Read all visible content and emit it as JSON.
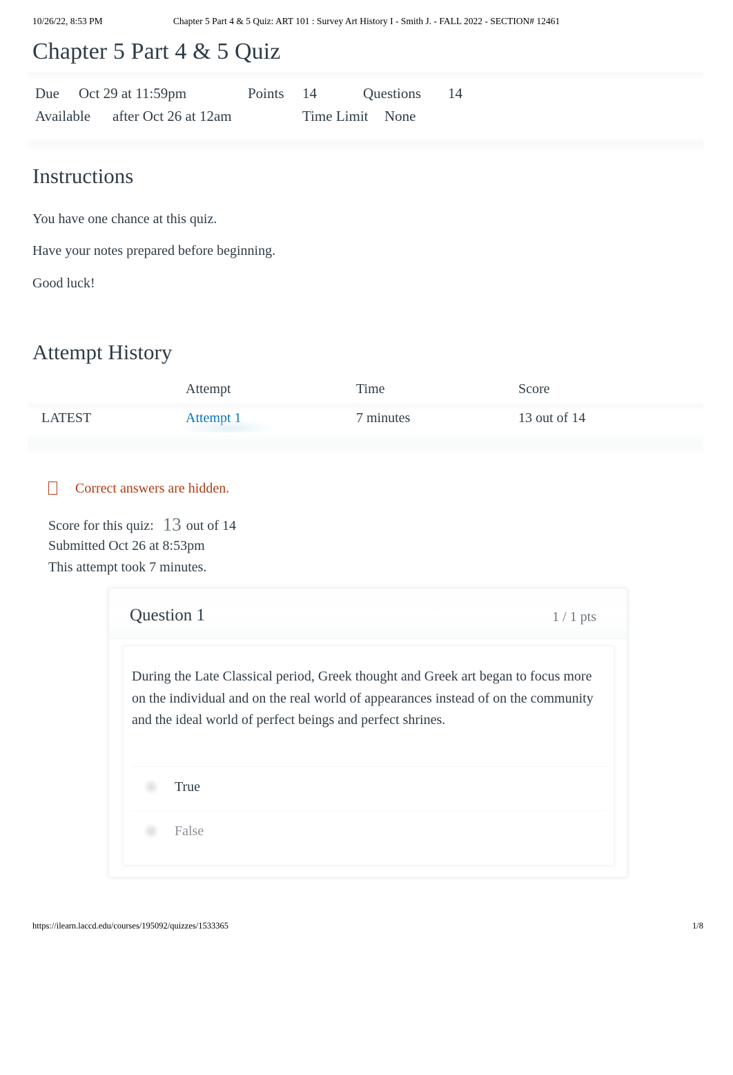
{
  "print_header": {
    "timestamp": "10/26/22, 8:53 PM",
    "document_title": "Chapter 5 Part 4 & 5 Quiz: ART 101 : Survey Art History I - Smith J. - FALL 2022 - SECTION# 12461"
  },
  "print_footer": {
    "url": "https://ilearn.laccd.edu/courses/195092/quizzes/1533365",
    "page_number": "1/8"
  },
  "quiz": {
    "title": "Chapter 5 Part 4 & 5 Quiz",
    "meta": {
      "due_label": "Due",
      "due_value": "Oct 29 at 11:59pm",
      "points_label": "Points",
      "points_value": "14",
      "questions_label": "Questions",
      "questions_value": "14",
      "available_label": "Available",
      "available_value": "after Oct 26 at 12am",
      "time_limit_label": "Time Limit",
      "time_limit_value": "None"
    }
  },
  "instructions": {
    "heading": "Instructions",
    "paragraphs": [
      "You have one chance at this quiz.",
      "Have your notes prepared before beginning.",
      "Good luck!"
    ]
  },
  "attempt_history": {
    "heading": "Attempt History",
    "columns": [
      "",
      "Attempt",
      "Time",
      "Score"
    ],
    "rows": [
      {
        "flag": "LATEST",
        "attempt": "Attempt 1",
        "time": "7 minutes",
        "score": "13 out of 14"
      }
    ]
  },
  "results": {
    "answers_hidden_notice": "Correct answers are hidden.",
    "answers_hidden_icon": "info-box-icon",
    "score_label": "Score for this quiz:",
    "score_value": "13",
    "score_out_of": "out of 14",
    "submitted": "Submitted Oct 26 at 8:53pm",
    "duration": "This attempt took 7 minutes."
  },
  "question": {
    "name": "Question 1",
    "points": "1 / 1 pts",
    "text": " During the Late Classical period, Greek thought and Greek art began to focus more on the individual and on the real world of appearances instead of on the community and the ideal world of perfect beings and perfect shrines.",
    "answers": [
      {
        "label": "True",
        "selected": true
      },
      {
        "label": "False",
        "selected": false
      }
    ]
  },
  "colors": {
    "text": "#2d3b45",
    "link": "#0374b5",
    "warning": "#ad3c14",
    "muted": "#6b7780",
    "muted_answer": "#8b9097"
  }
}
